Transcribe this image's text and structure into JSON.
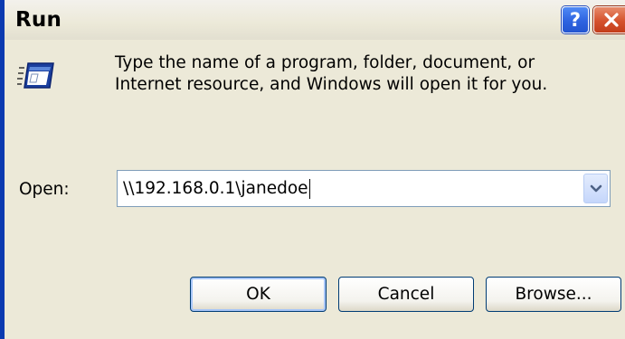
{
  "window": {
    "title": "Run",
    "help_label": "?"
  },
  "description": {
    "line1": "Type the name of a program, folder, document, or",
    "line2": "Internet resource, and Windows will open it for you."
  },
  "open_field": {
    "label": "Open:",
    "value": "\\\\192.168.0.1\\janedoe"
  },
  "buttons": {
    "ok": "OK",
    "cancel": "Cancel",
    "browse": "Browse..."
  },
  "icons": {
    "run": "run-program-icon",
    "close": "close-icon",
    "help": "help-icon",
    "dropdown": "chevron-down-icon"
  },
  "colors": {
    "title_bar_accent": "#0b3ab0",
    "dialog_background": "#ece9d8",
    "close_button": "#d5522d",
    "help_button": "#2e63e0"
  }
}
